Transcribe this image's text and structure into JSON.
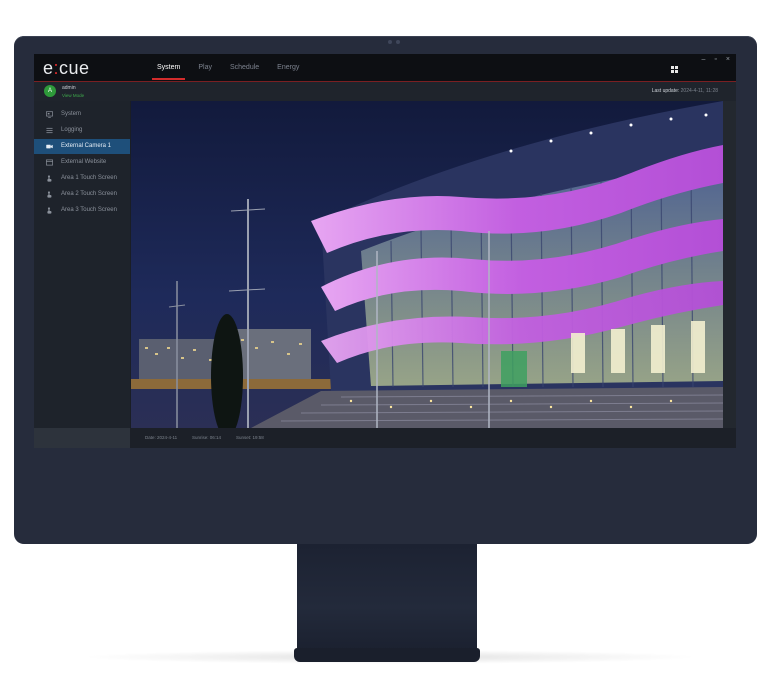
{
  "app": {
    "logo_pre": "e",
    "logo_accent": ":",
    "logo_post": "cue"
  },
  "tabs": [
    {
      "label": "System",
      "active": true
    },
    {
      "label": "Play",
      "active": false
    },
    {
      "label": "Schedule",
      "active": false
    },
    {
      "label": "Energy",
      "active": false
    }
  ],
  "window_controls": [
    "–",
    "▫",
    "×"
  ],
  "user": {
    "avatar_letter": "A",
    "name": "admin",
    "role": "View Mode"
  },
  "header": {
    "last_update_label": "Last update:",
    "last_update_value": "2024-4-11, 11:28"
  },
  "sidebar": {
    "items": [
      {
        "label": "System",
        "icon": "monitor-icon",
        "active": false
      },
      {
        "label": "Logging",
        "icon": "list-icon",
        "active": false
      },
      {
        "label": "External Camera 1",
        "icon": "video-camera-icon",
        "active": true
      },
      {
        "label": "External Website",
        "icon": "browser-icon",
        "active": false
      },
      {
        "label": "Area 1 Touch Screen",
        "icon": "touch-hand-icon",
        "active": false
      },
      {
        "label": "Area 2 Touch Screen",
        "icon": "touch-hand-icon",
        "active": false
      },
      {
        "label": "Area 3 Touch Screen",
        "icon": "touch-hand-icon",
        "active": false
      }
    ]
  },
  "status": {
    "date": "Date: 2024-4-11",
    "sunrise": "Sunrise: 06:14",
    "sunset": "Sunset: 19:58"
  },
  "colors": {
    "accent_red": "#d32c2c",
    "active_nav": "#1e4f7a",
    "avatar_green": "#2e9a3a",
    "facade_pink": "#d47be6",
    "night_sky": "#1c2550"
  }
}
